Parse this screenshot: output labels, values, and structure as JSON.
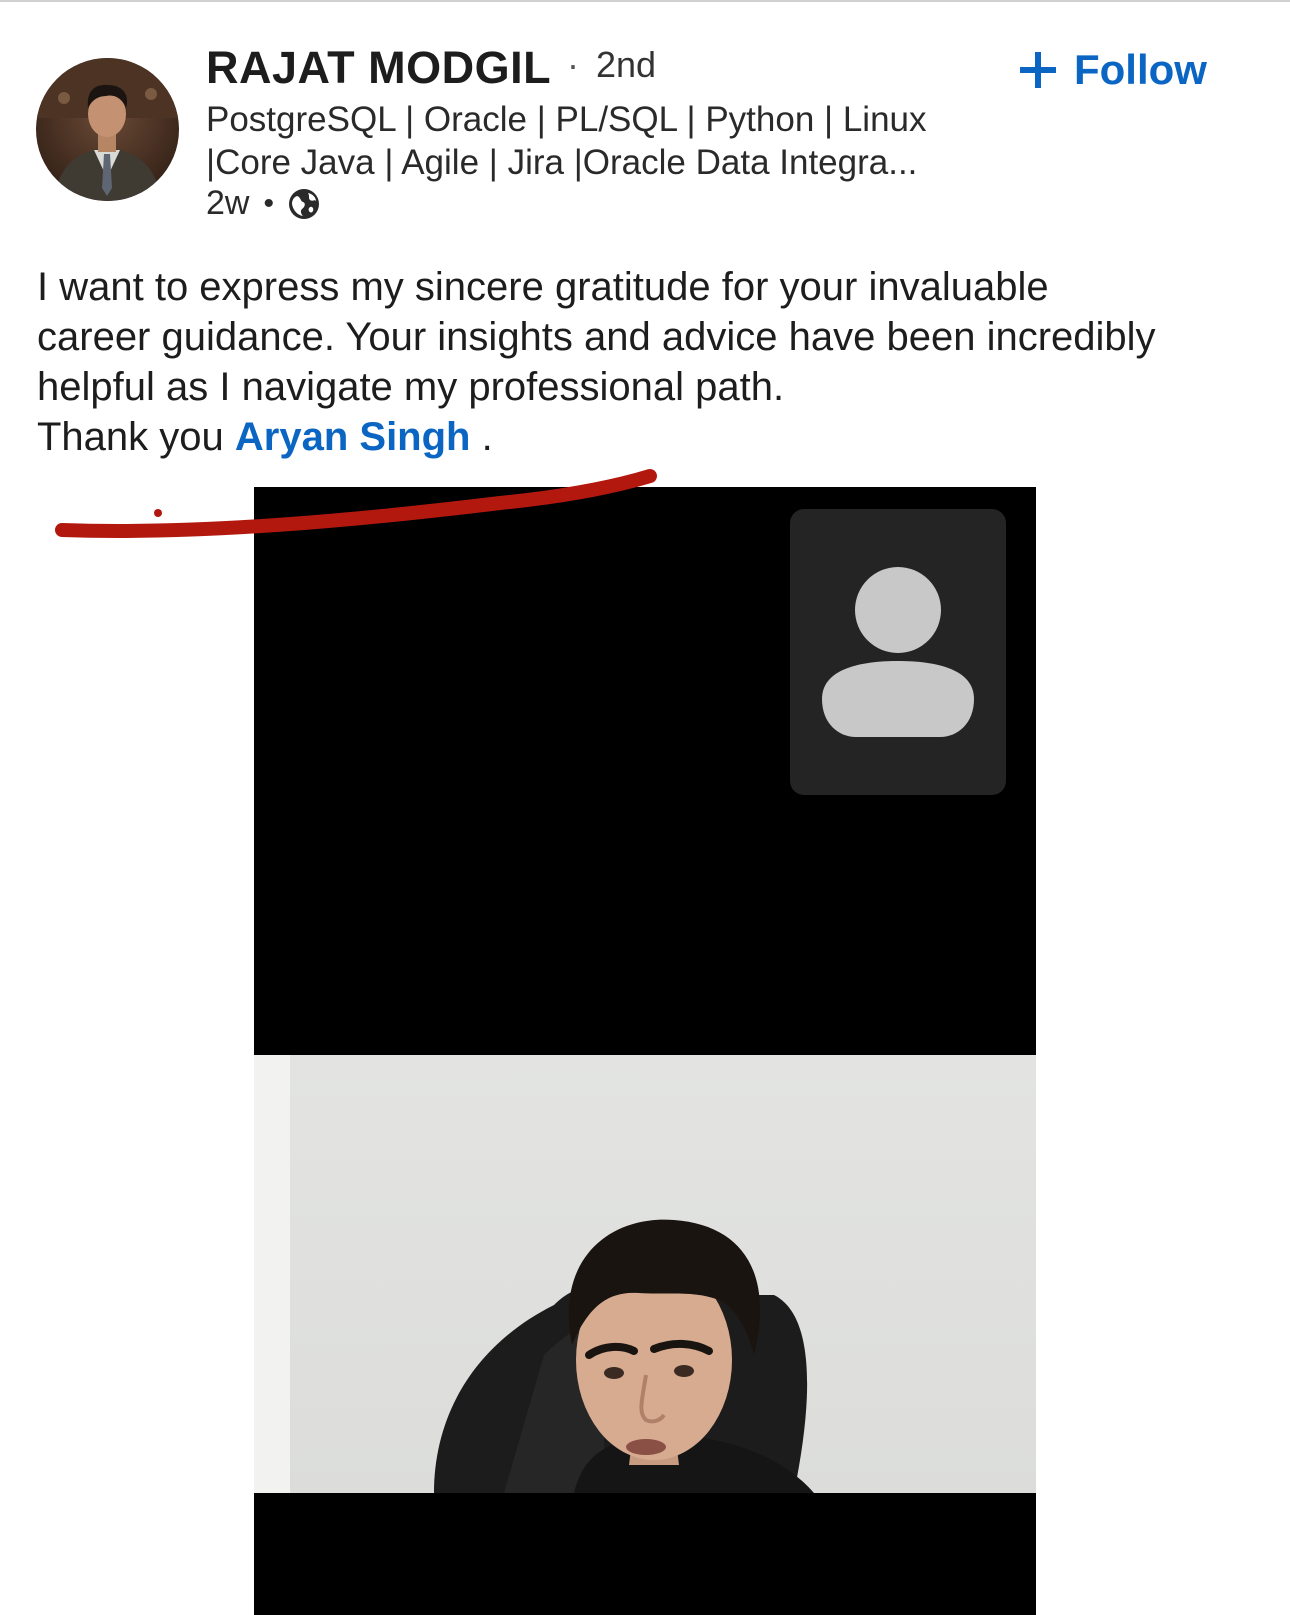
{
  "post": {
    "author": {
      "name": "RAJAT MODGIL",
      "separator": "·",
      "degree": "2nd",
      "headline_lines": [
        "PostgreSQL | Oracle | PL/SQL | Python | Linux",
        "|Core Java | Agile | Jira |Oracle Data Integra..."
      ],
      "time": "2w",
      "meta_separator": "•",
      "visibility_icon": "globe-icon"
    },
    "follow": {
      "label": "Follow",
      "icon": "plus-icon",
      "color": "#0a66c2"
    },
    "text": {
      "lines": [
        "I want to express my sincere gratitude for your invaluable",
        "career guidance. Your insights and advice have been incredibly",
        "helpful as I navigate my professional path."
      ],
      "thanks_prefix": "Thank you ",
      "mention": "Aryan Singh",
      "thanks_suffix": " ."
    },
    "media": {
      "type": "video-call-screenshot",
      "remote_participant_icon": "person-placeholder-icon",
      "self_view": "webcam view of a man seated in a black office chair"
    }
  },
  "colors": {
    "link": "#0a66c2",
    "annotation_stroke": "#b3180f",
    "video_background": "#000000",
    "tile_background": "#242424"
  }
}
